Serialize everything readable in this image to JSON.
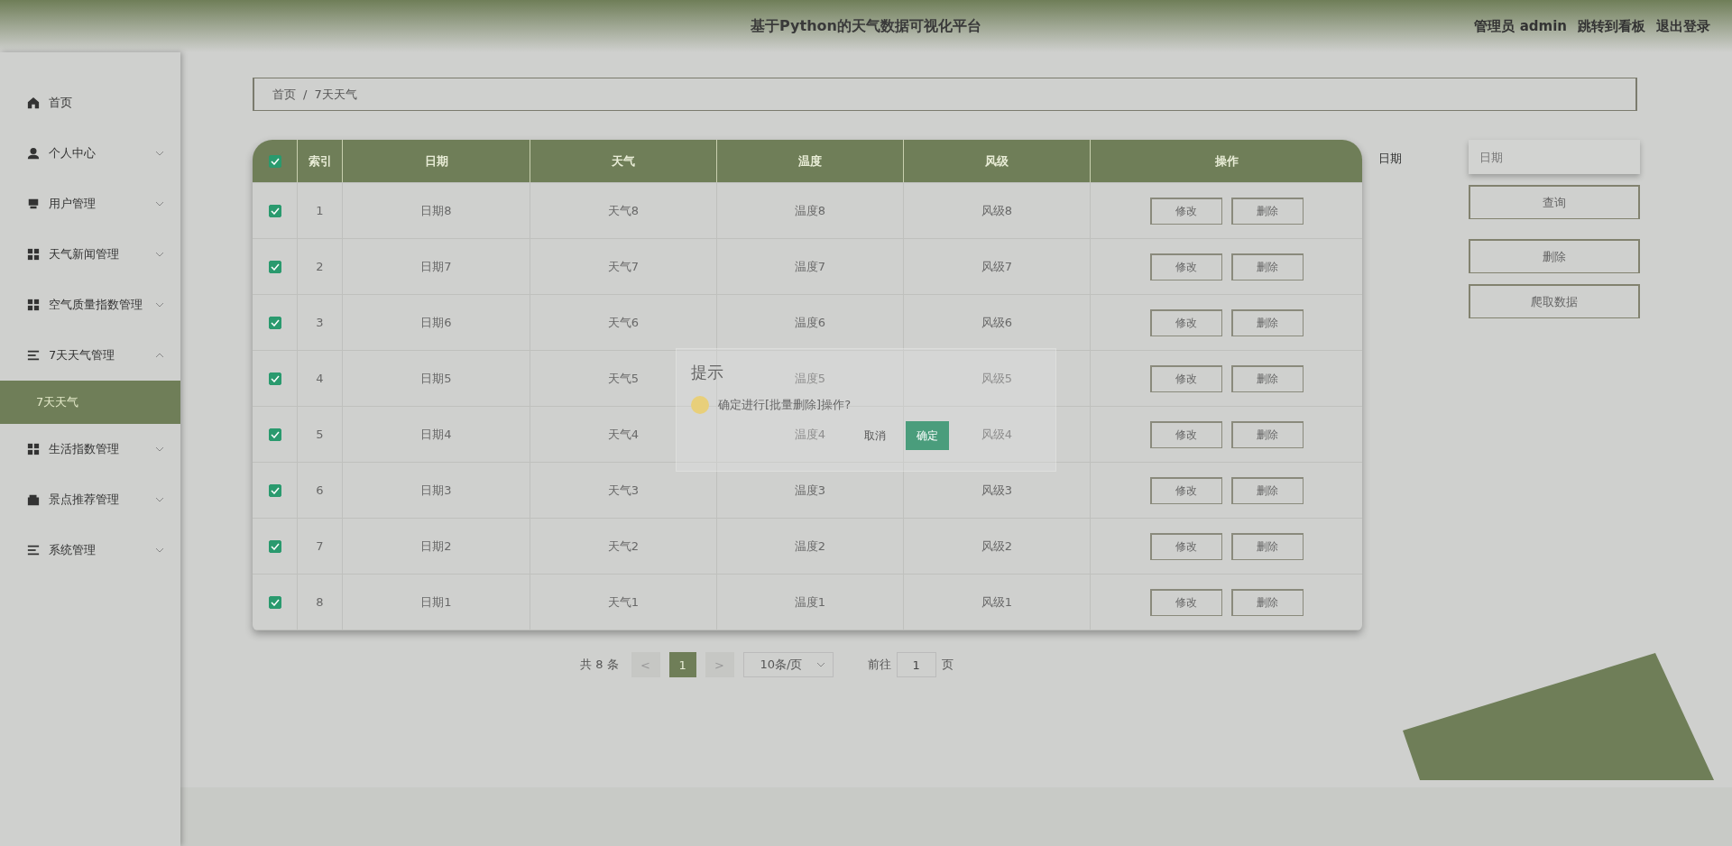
{
  "header": {
    "title": "基于Python的天气数据可视化平台",
    "user": "管理员 admin",
    "links": [
      "跳转到看板",
      "退出登录"
    ]
  },
  "sidebar": {
    "items": [
      {
        "label": "首页"
      },
      {
        "label": "个人中心",
        "expanded": false
      },
      {
        "label": "用户管理",
        "expanded": false
      },
      {
        "label": "天气新闻管理",
        "expanded": false
      },
      {
        "label": "空气质量指数管理",
        "expanded": false
      },
      {
        "label": "7天天气管理",
        "expanded": true,
        "children": [
          {
            "label": "7天天气",
            "selected": true
          }
        ]
      },
      {
        "label": "生活指数管理",
        "expanded": false
      },
      {
        "label": "景点推荐管理",
        "expanded": false
      },
      {
        "label": "系统管理",
        "expanded": false
      }
    ]
  },
  "breadcrumb": {
    "items": [
      "首页",
      "7天天气"
    ],
    "separator": "/"
  },
  "table": {
    "all_checked": true,
    "columns": [
      "索引",
      "日期",
      "天气",
      "温度",
      "风级",
      "操作"
    ],
    "rows": [
      {
        "checked": true,
        "cells": [
          "1",
          "日期8",
          "天气8",
          "温度8",
          "风级8"
        ],
        "actions": [
          "修改",
          "删除"
        ]
      },
      {
        "checked": true,
        "cells": [
          "2",
          "日期7",
          "天气7",
          "温度7",
          "风级7"
        ],
        "actions": [
          "修改",
          "删除"
        ]
      },
      {
        "checked": true,
        "cells": [
          "3",
          "日期6",
          "天气6",
          "温度6",
          "风级6"
        ],
        "actions": [
          "修改",
          "删除"
        ]
      },
      {
        "checked": true,
        "cells": [
          "4",
          "日期5",
          "天气5",
          "温度5",
          "风级5"
        ],
        "actions": [
          "修改",
          "删除"
        ]
      },
      {
        "checked": true,
        "cells": [
          "5",
          "日期4",
          "天气4",
          "温度4",
          "风级4"
        ],
        "actions": [
          "修改",
          "删除"
        ]
      },
      {
        "checked": true,
        "cells": [
          "6",
          "日期3",
          "天气3",
          "温度3",
          "风级3"
        ],
        "actions": [
          "修改",
          "删除"
        ]
      },
      {
        "checked": true,
        "cells": [
          "7",
          "日期2",
          "天气2",
          "温度2",
          "风级2"
        ],
        "actions": [
          "修改",
          "删除"
        ]
      },
      {
        "checked": true,
        "cells": [
          "8",
          "日期1",
          "天气1",
          "温度1",
          "风级1"
        ],
        "actions": [
          "修改",
          "删除"
        ]
      }
    ]
  },
  "search": {
    "label": "日期",
    "placeholder": "日期",
    "buttons": [
      "查询",
      "删除",
      "爬取数据"
    ]
  },
  "pagination": {
    "total": "共 8 条",
    "prev": "<",
    "pages": [
      {
        "label": "1",
        "selected": true
      }
    ],
    "next": ">",
    "page_size": "10条/页",
    "goto_label": "前往",
    "goto_value": "1",
    "goto_suffix": "页"
  },
  "dialog": {
    "title": "提示",
    "message": "确定进行[批量删除]操作?",
    "buttons": [
      "取消",
      "确定"
    ]
  }
}
